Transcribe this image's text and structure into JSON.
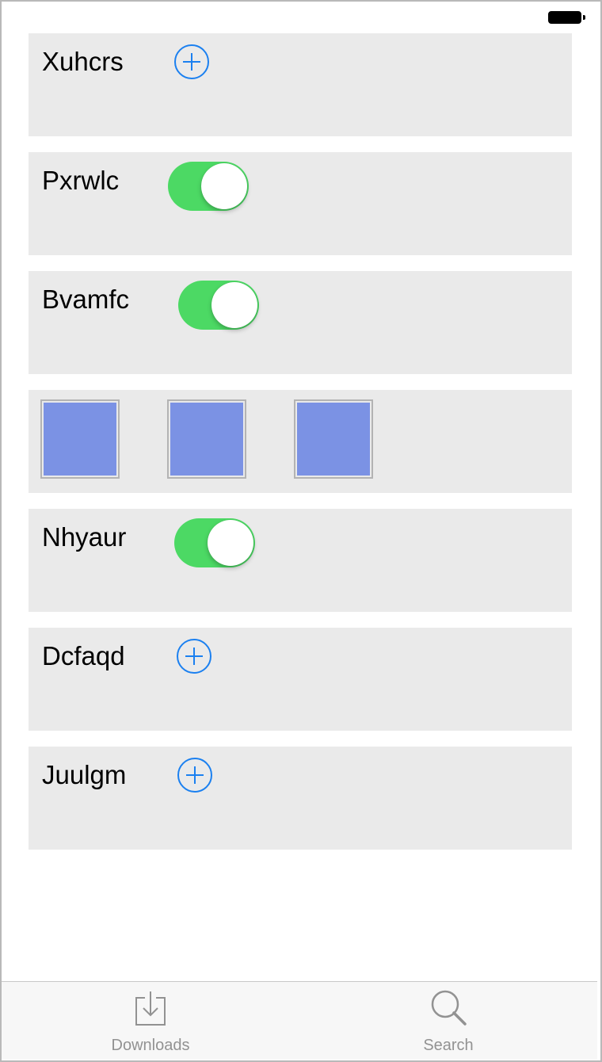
{
  "rows": [
    {
      "label": "Xuhcrs",
      "control": "add-button"
    },
    {
      "label": "Pxrwlc",
      "control": "toggle",
      "on": true
    },
    {
      "label": "Bvamfc",
      "control": "toggle",
      "on": true
    },
    {
      "label": "",
      "control": "tiles",
      "tile_count": 3
    },
    {
      "label": "Nhyaur",
      "control": "toggle",
      "on": true
    },
    {
      "label": "Dcfaqd",
      "control": "add-button"
    },
    {
      "label": "Juulgm",
      "control": "add-button"
    }
  ],
  "tabbar": {
    "downloads": {
      "label": "Downloads",
      "icon": "download-tray-icon"
    },
    "search": {
      "label": "Search",
      "icon": "magnifier-icon"
    }
  },
  "status_bar": {
    "battery_icon": "battery-icon"
  },
  "colors": {
    "toggle_on": "#4cd964",
    "add_button": "#1b80f0",
    "tile": "#7b92e4",
    "row_background": "#eaeaea",
    "tab_label": "#929292"
  }
}
